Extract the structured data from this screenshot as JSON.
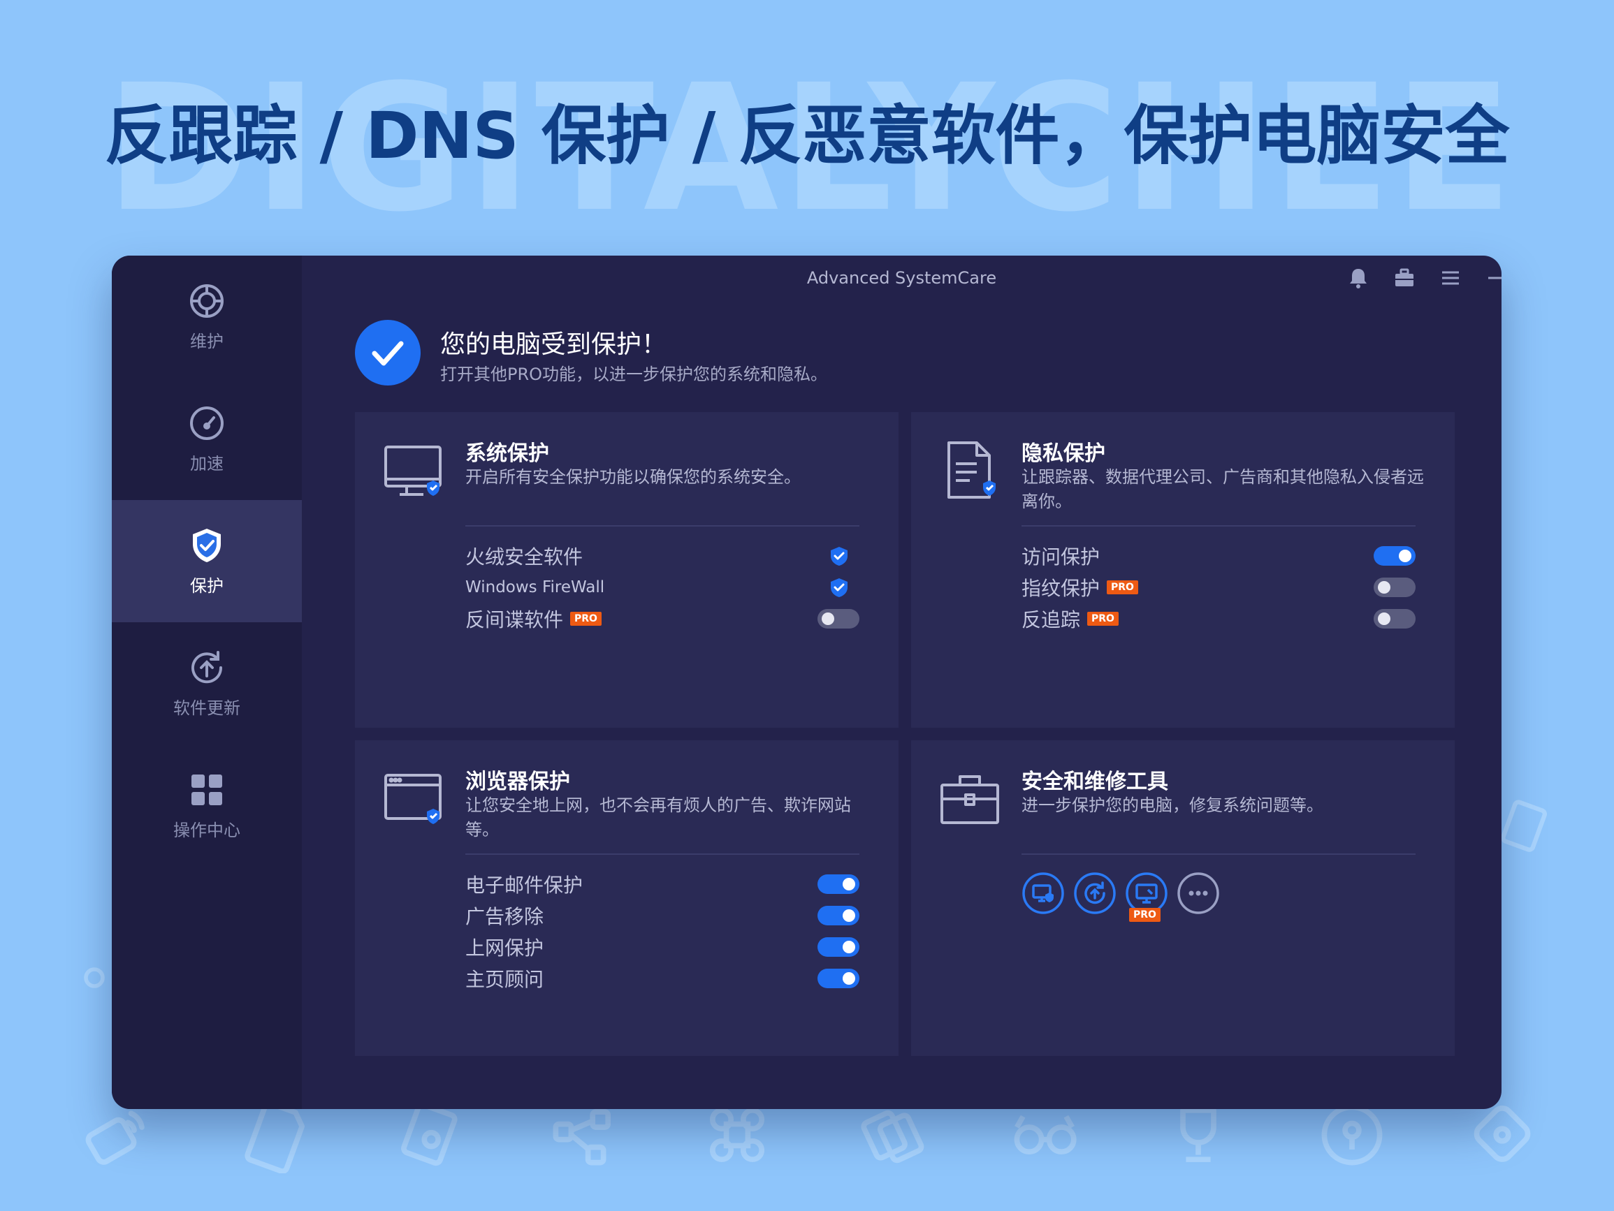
{
  "banner": {
    "watermark": "DIGITALYCHEE",
    "headline": "反跟踪 / DNS 保护 / 反恶意软件，保护电脑安全"
  },
  "app": {
    "title": "Advanced SystemCare"
  },
  "sidebar": {
    "items": [
      {
        "label": "维护",
        "icon": "maintenance-icon"
      },
      {
        "label": "加速",
        "icon": "speedometer-icon"
      },
      {
        "label": "保护",
        "icon": "shield-icon",
        "active": true
      },
      {
        "label": "软件更新",
        "icon": "update-icon"
      },
      {
        "label": "操作中心",
        "icon": "grid-icon"
      }
    ]
  },
  "status": {
    "title": "您的电脑受到保护！",
    "subtitle": "打开其他PRO功能，以进一步保护您的系统和隐私。"
  },
  "cards": {
    "system": {
      "title": "系统保护",
      "desc": "开启所有安全保护功能以确保您的系统安全。",
      "rows": [
        {
          "label": "火绒安全软件",
          "state": "shield"
        },
        {
          "label": "Windows FireWall",
          "state": "shield"
        },
        {
          "label": "反间谍软件",
          "pro": "PRO",
          "state": "off"
        }
      ]
    },
    "privacy": {
      "title": "隐私保护",
      "desc": "让跟踪器、数据代理公司、广告商和其他隐私入侵者远离你。",
      "rows": [
        {
          "label": "访问保护",
          "state": "on"
        },
        {
          "label": "指纹保护",
          "pro": "PRO",
          "state": "off"
        },
        {
          "label": "反追踪",
          "pro": "PRO",
          "state": "off"
        }
      ]
    },
    "browser": {
      "title": "浏览器保护",
      "desc": "让您安全地上网，也不会再有烦人的广告、欺诈网站等。",
      "rows": [
        {
          "label": "电子邮件保护",
          "state": "on"
        },
        {
          "label": "广告移除",
          "state": "on"
        },
        {
          "label": "上网保护",
          "state": "on"
        },
        {
          "label": "主页顾问",
          "state": "on"
        }
      ]
    },
    "tools": {
      "title": "安全和维修工具",
      "desc": "进一步保护您的电脑，修复系统问题等。",
      "tool_pro": "PRO"
    }
  },
  "colors": {
    "page_bg": "#8ec5fb",
    "headline": "#0f3e85",
    "app_bg": "#23224b",
    "card_bg": "#2a2a55",
    "accent": "#1f6ff2",
    "pro_badge": "#ee5a13"
  }
}
